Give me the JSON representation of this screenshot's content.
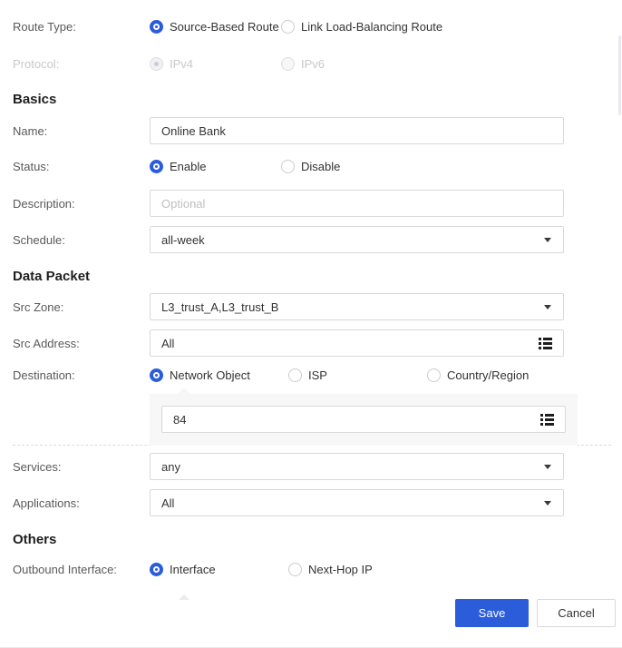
{
  "colors": {
    "accent": "#2b5cd9"
  },
  "route_type": {
    "label": "Route Type:",
    "options": [
      {
        "label": "Source-Based Route",
        "selected": true
      },
      {
        "label": "Link Load-Balancing Route",
        "selected": false
      }
    ]
  },
  "protocol": {
    "label": "Protocol:",
    "disabled": true,
    "options": [
      {
        "label": "IPv4",
        "selected": true
      },
      {
        "label": "IPv6",
        "selected": false
      }
    ]
  },
  "sections": {
    "basics": "Basics",
    "data_packet": "Data Packet",
    "others": "Others"
  },
  "name": {
    "label": "Name:",
    "value": "Online Bank"
  },
  "status": {
    "label": "Status:",
    "options": [
      {
        "label": "Enable",
        "selected": true
      },
      {
        "label": "Disable",
        "selected": false
      }
    ]
  },
  "description": {
    "label": "Description:",
    "placeholder": "Optional"
  },
  "schedule": {
    "label": "Schedule:",
    "value": "all-week"
  },
  "src_zone": {
    "label": "Src Zone:",
    "value": "L3_trust_A,L3_trust_B"
  },
  "src_address": {
    "label": "Src Address:",
    "value": "All"
  },
  "destination": {
    "label": "Destination:",
    "options": [
      {
        "label": "Network Object",
        "selected": true
      },
      {
        "label": "ISP",
        "selected": false
      },
      {
        "label": "Country/Region",
        "selected": false
      }
    ],
    "network_object_value": "84"
  },
  "services": {
    "label": "Services:",
    "value": "any"
  },
  "applications": {
    "label": "Applications:",
    "value": "All"
  },
  "outbound_interface": {
    "label": "Outbound Interface:",
    "options": [
      {
        "label": "Interface",
        "selected": true
      },
      {
        "label": "Next-Hop IP",
        "selected": false
      }
    ]
  },
  "footer": {
    "save": "Save",
    "cancel": "Cancel"
  }
}
